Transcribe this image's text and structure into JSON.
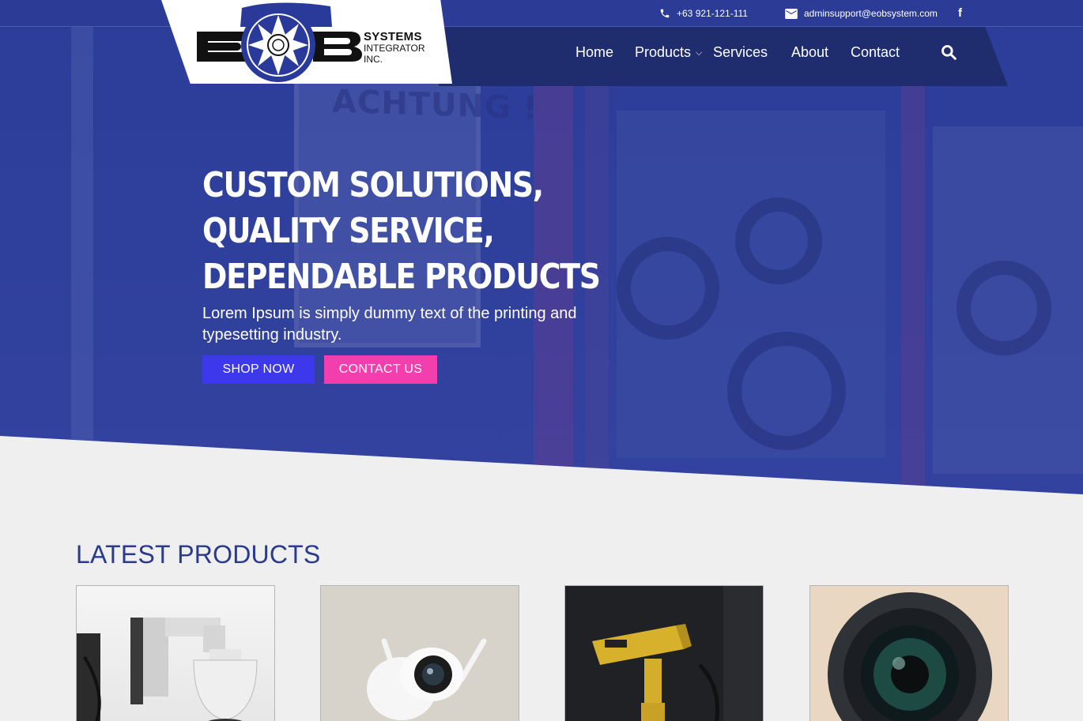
{
  "topbar": {
    "phone": "+63 921-121-111",
    "email": "adminsupport@eobsystem.com",
    "facebook": "f"
  },
  "logo": {
    "line1": "SYSTEMS",
    "line2": "INTEGRATOR",
    "line3": "INC.",
    "wordmark": "EOB"
  },
  "nav": {
    "items": [
      {
        "label": "Home"
      },
      {
        "label": "Products"
      },
      {
        "label": "Services"
      },
      {
        "label": "About"
      },
      {
        "label": "Contact"
      }
    ]
  },
  "hero": {
    "background_sign": "ACHTUNG !",
    "headline": [
      "CUSTOM SOLUTIONS,",
      "QUALITY SERVICE,",
      "DEPENDABLE PRODUCTS"
    ],
    "subtext": "Lorem Ipsum is simply dummy text of the printing and typesetting industry.",
    "shop_button": "SHOP NOW",
    "contact_button": "CONTACT US"
  },
  "products": {
    "title": "LATEST PRODUCTS",
    "cards": [
      {
        "image": "ptz-dome-camera"
      },
      {
        "image": "wifi-dome-camera"
      },
      {
        "image": "yellow-bullet-camera"
      },
      {
        "image": "camera-lens"
      }
    ]
  },
  "colors": {
    "hero_blue": "#2c3d98",
    "nav_dark": "#1f2d6e",
    "shop_button": "#3d38ec",
    "contact_button": "#f33fae",
    "section_title": "#2a3a8f"
  }
}
